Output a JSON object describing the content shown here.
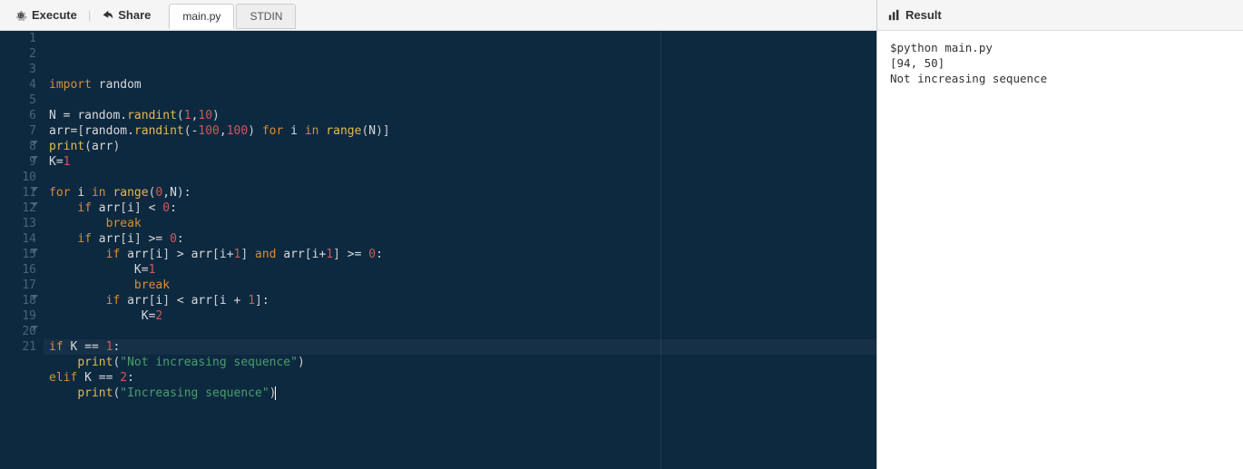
{
  "toolbar": {
    "execute_label": "Execute",
    "share_label": "Share"
  },
  "tabs": [
    {
      "label": "main.py",
      "active": true
    },
    {
      "label": "STDIN",
      "active": false
    }
  ],
  "editor": {
    "filename": "main.py",
    "cursor_line": 21,
    "lines": [
      {
        "n": 1,
        "fold": false,
        "tokens": [
          [
            "kw",
            "import"
          ],
          [
            "sp",
            " "
          ],
          [
            "id",
            "random"
          ]
        ]
      },
      {
        "n": 2,
        "fold": false,
        "tokens": []
      },
      {
        "n": 3,
        "fold": false,
        "tokens": [
          [
            "id",
            "N"
          ],
          [
            "sp",
            " "
          ],
          [
            "op",
            "="
          ],
          [
            "sp",
            " "
          ],
          [
            "id",
            "random"
          ],
          [
            "op",
            "."
          ],
          [
            "fn",
            "randint"
          ],
          [
            "pn",
            "("
          ],
          [
            "num",
            "1"
          ],
          [
            "op",
            ","
          ],
          [
            "num",
            "10"
          ],
          [
            "pn",
            ")"
          ]
        ]
      },
      {
        "n": 4,
        "fold": false,
        "tokens": [
          [
            "id",
            "arr"
          ],
          [
            "op",
            "="
          ],
          [
            "pn",
            "["
          ],
          [
            "id",
            "random"
          ],
          [
            "op",
            "."
          ],
          [
            "fn",
            "randint"
          ],
          [
            "pn",
            "("
          ],
          [
            "op",
            "-"
          ],
          [
            "num",
            "100"
          ],
          [
            "op",
            ","
          ],
          [
            "num",
            "100"
          ],
          [
            "pn",
            ")"
          ],
          [
            "sp",
            " "
          ],
          [
            "kw",
            "for"
          ],
          [
            "sp",
            " "
          ],
          [
            "id",
            "i"
          ],
          [
            "sp",
            " "
          ],
          [
            "kw",
            "in"
          ],
          [
            "sp",
            " "
          ],
          [
            "fn",
            "range"
          ],
          [
            "pn",
            "("
          ],
          [
            "id",
            "N"
          ],
          [
            "pn",
            ")"
          ],
          [
            "pn",
            "]"
          ]
        ]
      },
      {
        "n": 5,
        "fold": false,
        "tokens": [
          [
            "fn",
            "print"
          ],
          [
            "pn",
            "("
          ],
          [
            "id",
            "arr"
          ],
          [
            "pn",
            ")"
          ]
        ]
      },
      {
        "n": 6,
        "fold": false,
        "tokens": [
          [
            "id",
            "K"
          ],
          [
            "op",
            "="
          ],
          [
            "num",
            "1"
          ]
        ]
      },
      {
        "n": 7,
        "fold": false,
        "tokens": []
      },
      {
        "n": 8,
        "fold": true,
        "tokens": [
          [
            "kw",
            "for"
          ],
          [
            "sp",
            " "
          ],
          [
            "id",
            "i"
          ],
          [
            "sp",
            " "
          ],
          [
            "kw",
            "in"
          ],
          [
            "sp",
            " "
          ],
          [
            "fn",
            "range"
          ],
          [
            "pn",
            "("
          ],
          [
            "num",
            "0"
          ],
          [
            "op",
            ","
          ],
          [
            "id",
            "N"
          ],
          [
            "pn",
            ")"
          ],
          [
            "op",
            ":"
          ]
        ]
      },
      {
        "n": 9,
        "fold": true,
        "tokens": [
          [
            "sp",
            "    "
          ],
          [
            "kw",
            "if"
          ],
          [
            "sp",
            " "
          ],
          [
            "id",
            "arr"
          ],
          [
            "pn",
            "["
          ],
          [
            "id",
            "i"
          ],
          [
            "pn",
            "]"
          ],
          [
            "sp",
            " "
          ],
          [
            "op",
            "<"
          ],
          [
            "sp",
            " "
          ],
          [
            "num",
            "0"
          ],
          [
            "op",
            ":"
          ]
        ]
      },
      {
        "n": 10,
        "fold": false,
        "tokens": [
          [
            "sp",
            "        "
          ],
          [
            "kw",
            "break"
          ]
        ]
      },
      {
        "n": 11,
        "fold": true,
        "tokens": [
          [
            "sp",
            "    "
          ],
          [
            "kw",
            "if"
          ],
          [
            "sp",
            " "
          ],
          [
            "id",
            "arr"
          ],
          [
            "pn",
            "["
          ],
          [
            "id",
            "i"
          ],
          [
            "pn",
            "]"
          ],
          [
            "sp",
            " "
          ],
          [
            "op",
            ">="
          ],
          [
            "sp",
            " "
          ],
          [
            "num",
            "0"
          ],
          [
            "op",
            ":"
          ]
        ]
      },
      {
        "n": 12,
        "fold": true,
        "tokens": [
          [
            "sp",
            "        "
          ],
          [
            "kw",
            "if"
          ],
          [
            "sp",
            " "
          ],
          [
            "id",
            "arr"
          ],
          [
            "pn",
            "["
          ],
          [
            "id",
            "i"
          ],
          [
            "pn",
            "]"
          ],
          [
            "sp",
            " "
          ],
          [
            "op",
            ">"
          ],
          [
            "sp",
            " "
          ],
          [
            "id",
            "arr"
          ],
          [
            "pn",
            "["
          ],
          [
            "id",
            "i"
          ],
          [
            "op",
            "+"
          ],
          [
            "num",
            "1"
          ],
          [
            "pn",
            "]"
          ],
          [
            "sp",
            " "
          ],
          [
            "kw",
            "and"
          ],
          [
            "sp",
            " "
          ],
          [
            "id",
            "arr"
          ],
          [
            "pn",
            "["
          ],
          [
            "id",
            "i"
          ],
          [
            "op",
            "+"
          ],
          [
            "num",
            "1"
          ],
          [
            "pn",
            "]"
          ],
          [
            "sp",
            " "
          ],
          [
            "op",
            ">="
          ],
          [
            "sp",
            " "
          ],
          [
            "num",
            "0"
          ],
          [
            "op",
            ":"
          ]
        ]
      },
      {
        "n": 13,
        "fold": false,
        "tokens": [
          [
            "sp",
            "            "
          ],
          [
            "id",
            "K"
          ],
          [
            "op",
            "="
          ],
          [
            "num",
            "1"
          ]
        ]
      },
      {
        "n": 14,
        "fold": false,
        "tokens": [
          [
            "sp",
            "            "
          ],
          [
            "kw",
            "break"
          ]
        ]
      },
      {
        "n": 15,
        "fold": true,
        "tokens": [
          [
            "sp",
            "        "
          ],
          [
            "kw",
            "if"
          ],
          [
            "sp",
            " "
          ],
          [
            "id",
            "arr"
          ],
          [
            "pn",
            "["
          ],
          [
            "id",
            "i"
          ],
          [
            "pn",
            "]"
          ],
          [
            "sp",
            " "
          ],
          [
            "op",
            "<"
          ],
          [
            "sp",
            " "
          ],
          [
            "id",
            "arr"
          ],
          [
            "pn",
            "["
          ],
          [
            "id",
            "i"
          ],
          [
            "sp",
            " "
          ],
          [
            "op",
            "+"
          ],
          [
            "sp",
            " "
          ],
          [
            "num",
            "1"
          ],
          [
            "pn",
            "]"
          ],
          [
            "op",
            ":"
          ]
        ]
      },
      {
        "n": 16,
        "fold": false,
        "tokens": [
          [
            "sp",
            "             "
          ],
          [
            "id",
            "K"
          ],
          [
            "op",
            "="
          ],
          [
            "num",
            "2"
          ]
        ]
      },
      {
        "n": 17,
        "fold": false,
        "tokens": []
      },
      {
        "n": 18,
        "fold": true,
        "tokens": [
          [
            "kw",
            "if"
          ],
          [
            "sp",
            " "
          ],
          [
            "id",
            "K"
          ],
          [
            "sp",
            " "
          ],
          [
            "op",
            "=="
          ],
          [
            "sp",
            " "
          ],
          [
            "num",
            "1"
          ],
          [
            "op",
            ":"
          ]
        ]
      },
      {
        "n": 19,
        "fold": false,
        "tokens": [
          [
            "sp",
            "    "
          ],
          [
            "fn",
            "print"
          ],
          [
            "pn",
            "("
          ],
          [
            "str",
            "\"Not increasing sequence\""
          ],
          [
            "pn",
            ")"
          ]
        ]
      },
      {
        "n": 20,
        "fold": true,
        "tokens": [
          [
            "kw",
            "elif"
          ],
          [
            "sp",
            " "
          ],
          [
            "id",
            "K"
          ],
          [
            "sp",
            " "
          ],
          [
            "op",
            "=="
          ],
          [
            "sp",
            " "
          ],
          [
            "num",
            "2"
          ],
          [
            "op",
            ":"
          ]
        ]
      },
      {
        "n": 21,
        "fold": false,
        "tokens": [
          [
            "sp",
            "    "
          ],
          [
            "fn",
            "print"
          ],
          [
            "pn",
            "("
          ],
          [
            "str",
            "\"Increasing sequence\""
          ],
          [
            "pn",
            ")"
          ]
        ]
      }
    ]
  },
  "result": {
    "title": "Result",
    "command": "$python main.py",
    "output": "[94, 50]\nNot increasing sequence"
  }
}
